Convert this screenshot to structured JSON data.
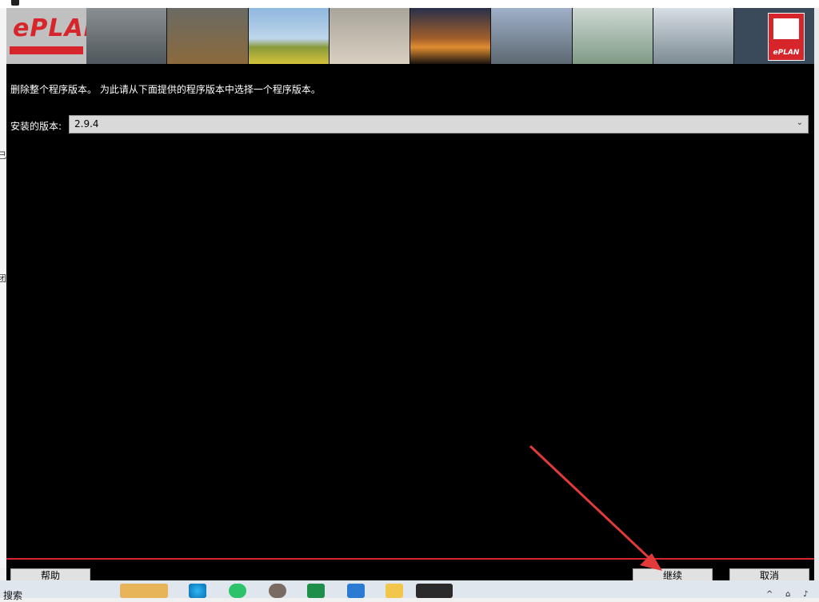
{
  "window": {
    "instruction": "删除整个程序版本。 为此请从下面提供的程序版本中选择一个程序版本。",
    "version_label": "安装的版本:",
    "version_value": "2.9.4"
  },
  "buttons": {
    "help": "帮助",
    "continue": "继续",
    "cancel": "取消"
  },
  "banner": {
    "logo_text": "ePLAN",
    "badge_text": "ePLAN"
  },
  "taskbar": {
    "search_label": "搜索"
  },
  "colors": {
    "brand_red": "#d7262b",
    "window_bg": "#000000"
  },
  "icons": [
    "app-icon",
    "eplan-logo",
    "chevron-down-icon",
    "annotation-arrow",
    "edge-icon",
    "wechat-icon",
    "avatar-icon",
    "app-green-icon",
    "teams-icon",
    "folder-icon",
    "eplan-task-icon"
  ]
}
